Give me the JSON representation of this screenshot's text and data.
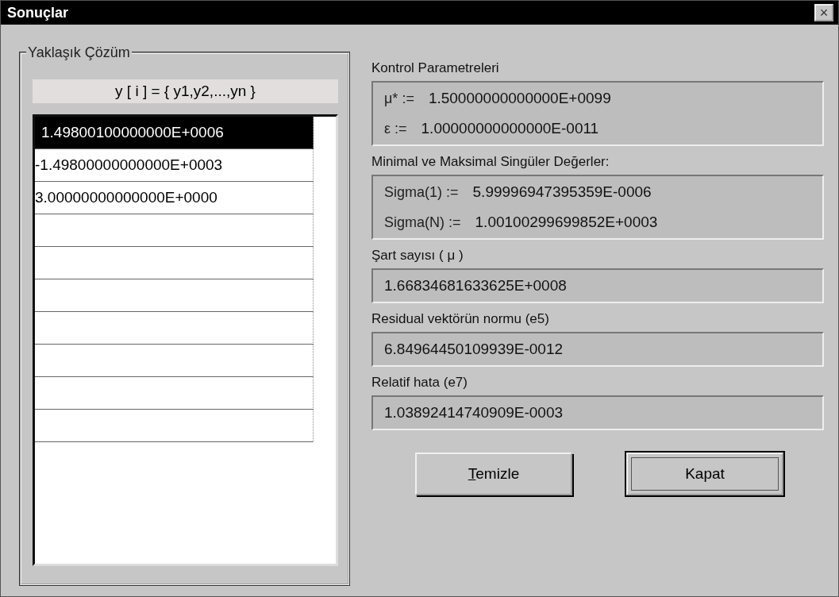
{
  "window": {
    "title": "Sonuçlar",
    "close": "×"
  },
  "solution": {
    "title": "Yaklaşık Çözüm",
    "header": "y [ i ] = { y1,y2,...,yn }",
    "rows": [
      {
        "value": "1.49800100000000E+0006",
        "selected": true
      },
      {
        "value": "-1.49800000000000E+0003",
        "selected": false
      },
      {
        "value": "3.00000000000000E+0000",
        "selected": false
      }
    ]
  },
  "sections": [
    {
      "title": "Kontrol Parametreleri",
      "lines": [
        {
          "label": "μ* :=",
          "value": "1.50000000000000E+0099"
        },
        {
          "label": "ε  :=",
          "value": "1.00000000000000E-0011"
        }
      ]
    },
    {
      "title": "Minimal ve Maksimal Singüler Değerler:",
      "lines": [
        {
          "label": "Sigma(1) :=",
          "value": "5.99996947395359E-0006"
        },
        {
          "label": "Sigma(N) :=",
          "value": "1.00100299699852E+0003"
        }
      ]
    },
    {
      "title": "Şart sayısı  ( μ )",
      "lines": [
        {
          "value": "1.66834681633625E+0008"
        }
      ]
    },
    {
      "title": "Residual vektörün normu (e5)",
      "lines": [
        {
          "value": "6.84964450109939E-0012"
        }
      ]
    },
    {
      "title": "Relatif hata (e7)",
      "lines": [
        {
          "value": "1.03892414740909E-0003"
        }
      ]
    }
  ],
  "buttons": [
    {
      "label": "Temizle",
      "underline_first": true,
      "default": false
    },
    {
      "label": "Kapat",
      "underline_first": false,
      "default": true
    }
  ]
}
